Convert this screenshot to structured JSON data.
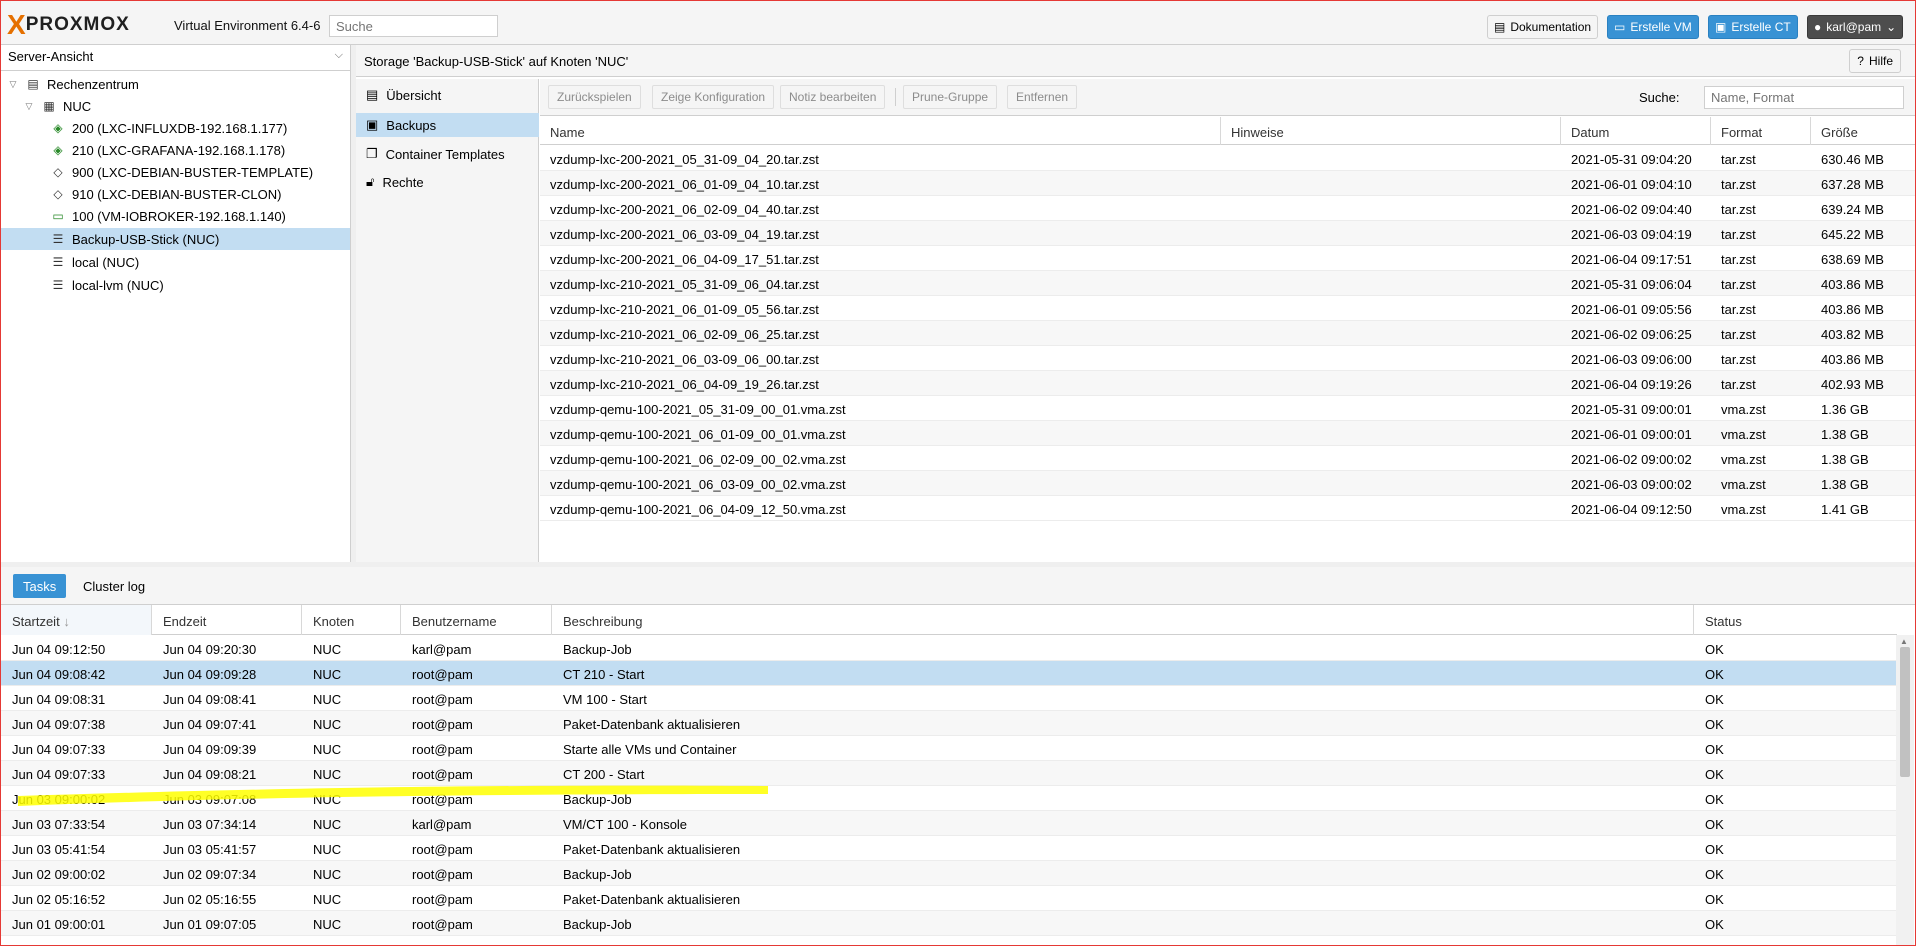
{
  "header": {
    "logo_text": "PROXMOX",
    "version": "Virtual Environment 6.4-6",
    "search_placeholder": "Suche",
    "doc_button": "Dokumentation",
    "create_vm_button": "Erstelle VM",
    "create_ct_button": "Erstelle CT",
    "user_button": "karl@pam"
  },
  "tree": {
    "view_select": "Server-Ansicht",
    "items": [
      {
        "label": "Rechenzentrum",
        "icon": "datacenter-icon"
      },
      {
        "label": "NUC",
        "icon": "node-icon"
      },
      {
        "label": "200 (LXC-INFLUXDB-192.168.1.177)",
        "icon": "container-running-icon"
      },
      {
        "label": "210 (LXC-GRAFANA-192.168.1.178)",
        "icon": "container-running-icon"
      },
      {
        "label": "900 (LXC-DEBIAN-BUSTER-TEMPLATE)",
        "icon": "template-icon"
      },
      {
        "label": "910 (LXC-DEBIAN-BUSTER-CLON)",
        "icon": "container-stopped-icon"
      },
      {
        "label": "100 (VM-IOBROKER-192.168.1.140)",
        "icon": "vm-running-icon"
      },
      {
        "label": "Backup-USB-Stick (NUC)",
        "icon": "storage-icon"
      },
      {
        "label": "local (NUC)",
        "icon": "storage-icon"
      },
      {
        "label": "local-lvm (NUC)",
        "icon": "storage-icon"
      }
    ]
  },
  "content": {
    "title": "Storage 'Backup-USB-Stick' auf Knoten 'NUC'",
    "help_button": "Hilfe",
    "nav": [
      "Übersicht",
      "Backups",
      "Container Templates",
      "Rechte"
    ],
    "toolbar": {
      "restore": "Zurückspielen",
      "show_config": "Zeige Konfiguration",
      "edit_note": "Notiz bearbeiten",
      "prune": "Prune-Gruppe",
      "remove": "Entfernen",
      "search_label": "Suche:",
      "search_placeholder": "Name, Format"
    },
    "columns": [
      "Name",
      "Hinweise",
      "Datum",
      "Format",
      "Größe"
    ],
    "rows": [
      [
        "vzdump-lxc-200-2021_05_31-09_04_20.tar.zst",
        "",
        "2021-05-31 09:04:20",
        "tar.zst",
        "630.46 MB"
      ],
      [
        "vzdump-lxc-200-2021_06_01-09_04_10.tar.zst",
        "",
        "2021-06-01 09:04:10",
        "tar.zst",
        "637.28 MB"
      ],
      [
        "vzdump-lxc-200-2021_06_02-09_04_40.tar.zst",
        "",
        "2021-06-02 09:04:40",
        "tar.zst",
        "639.24 MB"
      ],
      [
        "vzdump-lxc-200-2021_06_03-09_04_19.tar.zst",
        "",
        "2021-06-03 09:04:19",
        "tar.zst",
        "645.22 MB"
      ],
      [
        "vzdump-lxc-200-2021_06_04-09_17_51.tar.zst",
        "",
        "2021-06-04 09:17:51",
        "tar.zst",
        "638.69 MB"
      ],
      [
        "vzdump-lxc-210-2021_05_31-09_06_04.tar.zst",
        "",
        "2021-05-31 09:06:04",
        "tar.zst",
        "403.86 MB"
      ],
      [
        "vzdump-lxc-210-2021_06_01-09_05_56.tar.zst",
        "",
        "2021-06-01 09:05:56",
        "tar.zst",
        "403.86 MB"
      ],
      [
        "vzdump-lxc-210-2021_06_02-09_06_25.tar.zst",
        "",
        "2021-06-02 09:06:25",
        "tar.zst",
        "403.82 MB"
      ],
      [
        "vzdump-lxc-210-2021_06_03-09_06_00.tar.zst",
        "",
        "2021-06-03 09:06:00",
        "tar.zst",
        "403.86 MB"
      ],
      [
        "vzdump-lxc-210-2021_06_04-09_19_26.tar.zst",
        "",
        "2021-06-04 09:19:26",
        "tar.zst",
        "402.93 MB"
      ],
      [
        "vzdump-qemu-100-2021_05_31-09_00_01.vma.zst",
        "",
        "2021-05-31 09:00:01",
        "vma.zst",
        "1.36 GB"
      ],
      [
        "vzdump-qemu-100-2021_06_01-09_00_01.vma.zst",
        "",
        "2021-06-01 09:00:01",
        "vma.zst",
        "1.38 GB"
      ],
      [
        "vzdump-qemu-100-2021_06_02-09_00_02.vma.zst",
        "",
        "2021-06-02 09:00:02",
        "vma.zst",
        "1.38 GB"
      ],
      [
        "vzdump-qemu-100-2021_06_03-09_00_02.vma.zst",
        "",
        "2021-06-03 09:00:02",
        "vma.zst",
        "1.38 GB"
      ],
      [
        "vzdump-qemu-100-2021_06_04-09_12_50.vma.zst",
        "",
        "2021-06-04 09:12:50",
        "vma.zst",
        "1.41 GB"
      ]
    ]
  },
  "tasks": {
    "tabs": [
      "Tasks",
      "Cluster log"
    ],
    "columns": [
      "Startzeit",
      "Endzeit",
      "Knoten",
      "Benutzername",
      "Beschreibung",
      "Status"
    ],
    "rows": [
      [
        "Jun 04 09:12:50",
        "Jun 04 09:20:30",
        "NUC",
        "karl@pam",
        "Backup-Job",
        "OK"
      ],
      [
        "Jun 04 09:08:42",
        "Jun 04 09:09:28",
        "NUC",
        "root@pam",
        "CT 210 - Start",
        "OK"
      ],
      [
        "Jun 04 09:08:31",
        "Jun 04 09:08:41",
        "NUC",
        "root@pam",
        "VM 100 - Start",
        "OK"
      ],
      [
        "Jun 04 09:07:38",
        "Jun 04 09:07:41",
        "NUC",
        "root@pam",
        "Paket-Datenbank aktualisieren",
        "OK"
      ],
      [
        "Jun 04 09:07:33",
        "Jun 04 09:09:39",
        "NUC",
        "root@pam",
        "Starte alle VMs und Container",
        "OK"
      ],
      [
        "Jun 04 09:07:33",
        "Jun 04 09:08:21",
        "NUC",
        "root@pam",
        "CT 200 - Start",
        "OK"
      ],
      [
        "Jun 03 09:00:02",
        "Jun 03 09:07:08",
        "NUC",
        "root@pam",
        "Backup-Job",
        "OK"
      ],
      [
        "Jun 03 07:33:54",
        "Jun 03 07:34:14",
        "NUC",
        "karl@pam",
        "VM/CT 100 - Konsole",
        "OK"
      ],
      [
        "Jun 03 05:41:54",
        "Jun 03 05:41:57",
        "NUC",
        "root@pam",
        "Paket-Datenbank aktualisieren",
        "OK"
      ],
      [
        "Jun 02 09:00:02",
        "Jun 02 09:07:34",
        "NUC",
        "root@pam",
        "Backup-Job",
        "OK"
      ],
      [
        "Jun 02 05:16:52",
        "Jun 02 05:16:55",
        "NUC",
        "root@pam",
        "Paket-Datenbank aktualisieren",
        "OK"
      ],
      [
        "Jun 01 09:00:01",
        "Jun 01 09:07:05",
        "NUC",
        "root@pam",
        "Backup-Job",
        "OK"
      ]
    ]
  },
  "colors": {
    "accent": "#3892d4",
    "selection": "#c2ddf2",
    "brand": "#e57000",
    "highlight": "#ffff00"
  }
}
